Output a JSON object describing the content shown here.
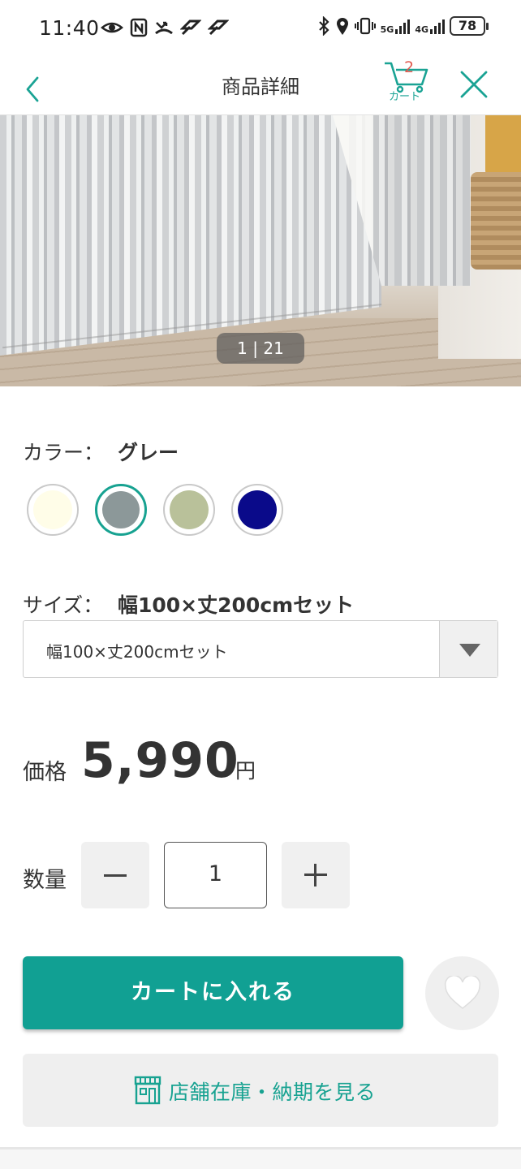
{
  "status_bar": {
    "time": "11:40",
    "battery": "78",
    "net_5g": "5G",
    "net_4g": "4G",
    "icons": [
      "eye-icon",
      "nfc-icon",
      "missed-call-icon",
      "app-notification-icon",
      "app-notification-icon",
      "bluetooth-icon",
      "location-icon",
      "vibrate-icon",
      "wifi-calling-icon",
      "signal-icon",
      "battery-icon"
    ]
  },
  "header": {
    "title": "商品詳細",
    "cart_count": "2",
    "cart_label": "カート",
    "accent_color": "#1aa394"
  },
  "gallery": {
    "counter": "1 | 21"
  },
  "color": {
    "label": "カラー：",
    "selected": "グレー",
    "swatches": [
      {
        "color": "#fffde8",
        "selected": false
      },
      {
        "color": "#8c9899",
        "selected": true
      },
      {
        "color": "#b9c19a",
        "selected": false
      },
      {
        "color": "#0a0a8a",
        "selected": false
      }
    ]
  },
  "size": {
    "label": "サイズ：",
    "selected": "幅100×丈200cmセット",
    "select_value": "幅100×丈200cmセット"
  },
  "price": {
    "label": "価格",
    "value": "5,990",
    "unit": "円"
  },
  "quantity": {
    "label": "数量",
    "value": "1"
  },
  "actions": {
    "add_to_cart": "カートに入れる",
    "store_stock": "店舗在庫・納期を見る",
    "primary_color": "#11a093"
  }
}
